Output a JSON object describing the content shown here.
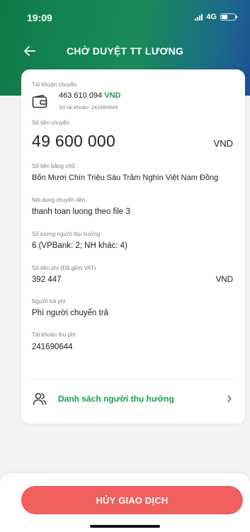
{
  "status_bar": {
    "time": "19:09",
    "network": "4G"
  },
  "nav": {
    "title": "CHỜ DUYỆT TT LƯƠNG"
  },
  "details": {
    "source_account_label": "Tài khoản chuyển",
    "source_account_number": "463 610 094",
    "source_account_currency": "VND",
    "source_account_sub": "Số tài khoản: 241690644",
    "amount_label": "Số tiền chuyển",
    "amount": "49 600 000",
    "amount_currency": "VND",
    "amount_words_label": "Số tiền bằng chữ",
    "amount_words": "Bốn Mươi Chín Triệu Sáu Trăm Nghìn Việt Nam Đồng",
    "content_label": "Nội dung chuyển tiền",
    "content": "thanh toan luong theo file 3",
    "beneficiary_count_label": "Số lượng người thụ hưởng",
    "beneficiary_count": "6  (VPBank: 2; NH khác: 4)",
    "fee_label": "Số tiền phí (Đã gồm VAT)",
    "fee": "392 447",
    "fee_currency": "VND",
    "fee_payer_label": "Người trả phí",
    "fee_payer": "Phí người chuyển trả",
    "fee_account_label": "Tài khoản thu phí",
    "fee_account": "241690644"
  },
  "beneficiary_list": {
    "label": "Danh sách người thụ hưởng"
  },
  "footer": {
    "cancel_label": "HỦY GIAO DỊCH"
  },
  "colors": {
    "accent": "#1aa04c",
    "danger": "#f15f5f",
    "header_start": "#0f7a46",
    "header_end": "#1f4f96"
  },
  "icons": [
    "back-arrow-icon",
    "wallet-icon",
    "users-icon",
    "chevron-right-icon",
    "signal-icon",
    "battery-icon"
  ]
}
